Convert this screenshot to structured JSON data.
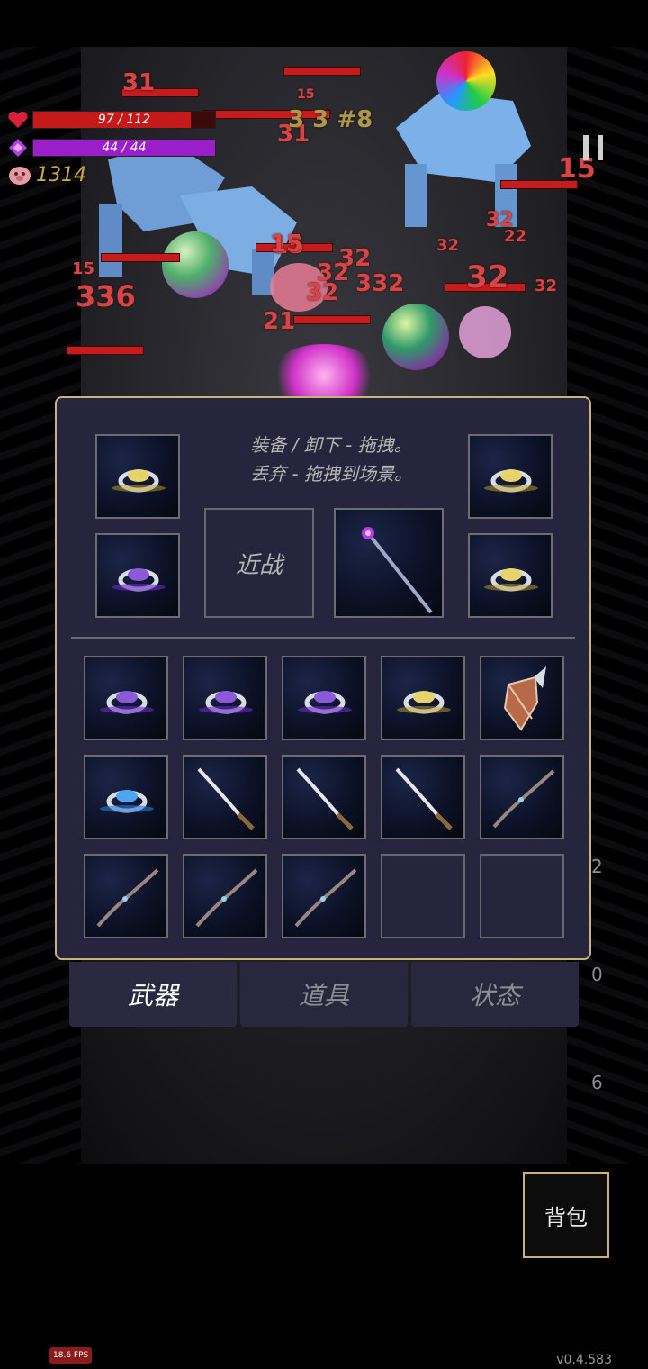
{
  "hud": {
    "hp_text": "97 / 112",
    "hp_fraction": 0.866,
    "mp_text": "44 / 44",
    "mp_fraction": 1.0,
    "gold": "1314",
    "colors": {
      "hp": "#c61a1a",
      "mp": "#9b1fc9",
      "gold": "#c9a64a"
    }
  },
  "scene": {
    "damage_numbers": [
      "31",
      "15",
      "15",
      "31",
      "15",
      "336",
      "21",
      "15",
      "32",
      "332",
      "32",
      "32",
      "32",
      "32",
      "32",
      "15",
      "32",
      "22",
      "3 3 #8"
    ],
    "right_counts": [
      "2",
      "0",
      "6"
    ]
  },
  "inventory": {
    "instruction_line1": "装备 / 卸下 - 拖拽。",
    "instruction_line2": "丢弃 - 拖拽到场景。",
    "melee_slot_label": "近战",
    "equipped": {
      "left_top": "ring-gold-gem",
      "left_bottom": "ring-purple-gem",
      "right_top": "ring-gold-gem",
      "right_bottom": "ring-gold-gem",
      "weapon": "magic-staff"
    },
    "grid": [
      [
        "ring-purple",
        "ring-purple",
        "ring-purple",
        "ring-gold",
        "shield"
      ],
      [
        "ring-blue",
        "katana",
        "katana",
        "katana",
        "bow"
      ],
      [
        "bow",
        "bow",
        "bow",
        "empty",
        "empty"
      ]
    ]
  },
  "tabs": [
    "武器",
    "道具",
    "状态"
  ],
  "active_tab": 0,
  "bag_button": "背包",
  "fps": "18.6 FPS",
  "version": "v0.4.583"
}
